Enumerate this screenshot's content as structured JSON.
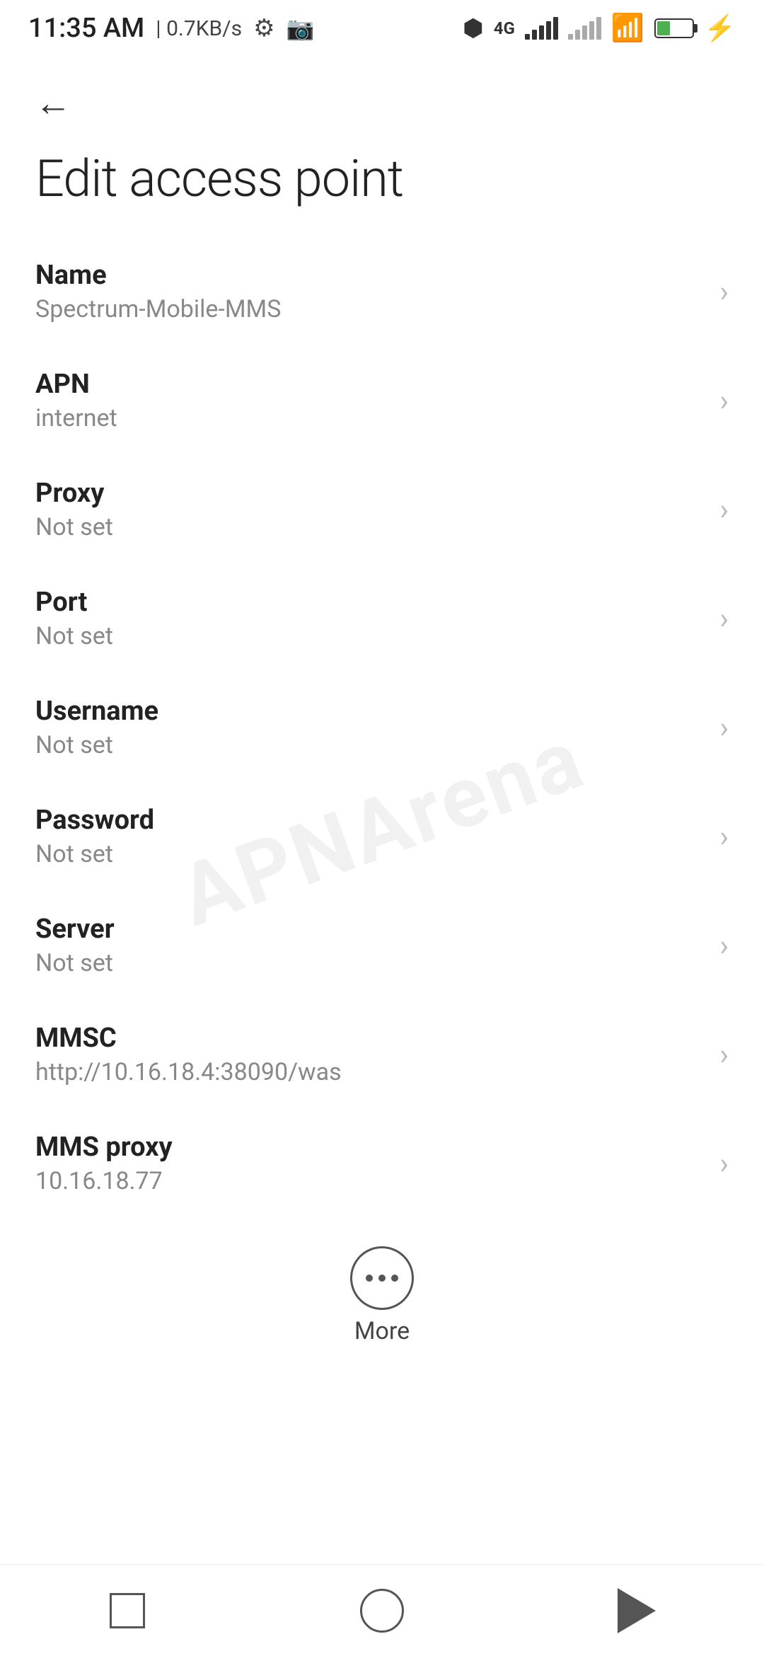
{
  "statusBar": {
    "time": "11:35 AM",
    "speed": "0.7KB/s"
  },
  "page": {
    "title": "Edit access point",
    "backLabel": "Back"
  },
  "fields": [
    {
      "label": "Name",
      "value": "Spectrum-Mobile-MMS"
    },
    {
      "label": "APN",
      "value": "internet"
    },
    {
      "label": "Proxy",
      "value": "Not set"
    },
    {
      "label": "Port",
      "value": "Not set"
    },
    {
      "label": "Username",
      "value": "Not set"
    },
    {
      "label": "Password",
      "value": "Not set"
    },
    {
      "label": "Server",
      "value": "Not set"
    },
    {
      "label": "MMSC",
      "value": "http://10.16.18.4:38090/was"
    },
    {
      "label": "MMS proxy",
      "value": "10.16.18.77"
    }
  ],
  "more": {
    "label": "More"
  },
  "watermark": "APNArena"
}
